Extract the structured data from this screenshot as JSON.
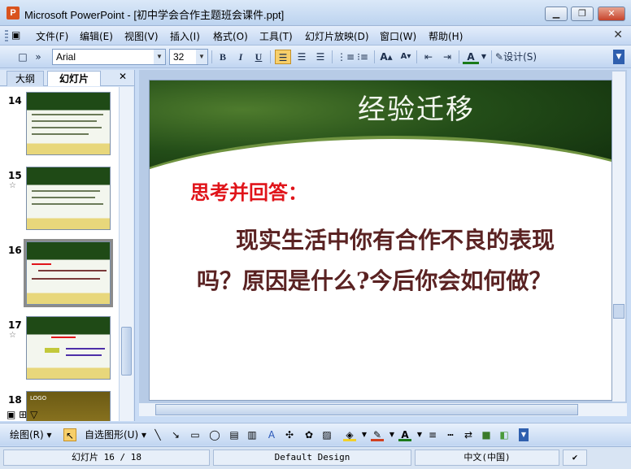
{
  "window": {
    "app_icon": "P",
    "title": "Microsoft PowerPoint - [初中学会合作主题班会课件.ppt]",
    "buttons": [
      "minimize",
      "restore",
      "close"
    ]
  },
  "menu": {
    "items": [
      "文件(F)",
      "编辑(E)",
      "视图(V)",
      "插入(I)",
      "格式(O)",
      "工具(T)",
      "幻灯片放映(D)",
      "窗口(W)",
      "帮助(H)"
    ],
    "close_glyph": "✕"
  },
  "toolbar": {
    "font": "Arial",
    "size": "32",
    "bold": "B",
    "italic": "I",
    "underline": "U",
    "design_label": "设计(S)"
  },
  "left_pane": {
    "tabs": [
      "大纲",
      "幻灯片"
    ],
    "close_glyph": "✕",
    "slides": [
      {
        "number": "14",
        "has_star": false,
        "selected": false
      },
      {
        "number": "15",
        "has_star": true,
        "selected": false
      },
      {
        "number": "16",
        "has_star": false,
        "selected": true
      },
      {
        "number": "17",
        "has_star": true,
        "selected": false
      },
      {
        "number": "18",
        "has_star": false,
        "selected": false
      }
    ],
    "slide18_logo": "LOGO"
  },
  "slide": {
    "title": "经验迁移",
    "subtitle": "思考并回答：",
    "body_line1": "现实生活中你有合作不良的表现",
    "body_line2": "吗？原因是什么?今后你会如何做？"
  },
  "drawing_toolbar": {
    "draw_label": "绘图(R)",
    "autoshapes_label": "自选图形(U)"
  },
  "status": {
    "slide_info": "幻灯片 16 / 18",
    "design": "Default Design",
    "language": "中文(中国)"
  },
  "colors": {
    "accent_red": "#e0141a",
    "body_text": "#5a2222",
    "banner_green": "#234d18"
  }
}
